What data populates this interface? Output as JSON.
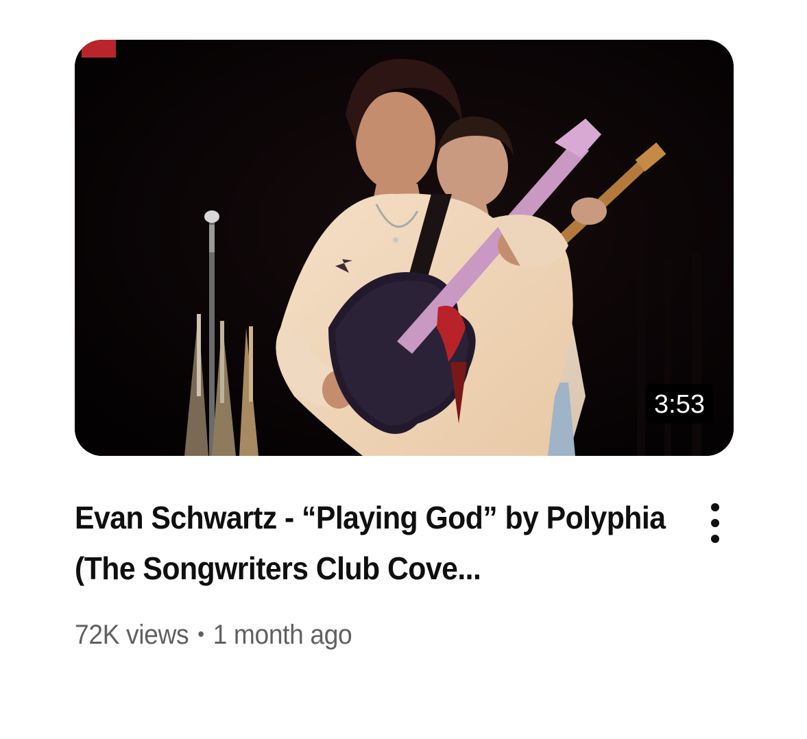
{
  "video": {
    "duration": "3:53",
    "title": "Evan Schwartz - “Playing God” by Polyphia (The Songwriters Club Cove...",
    "views": "72K views",
    "separator": "•",
    "age": "1 month ago"
  },
  "icons": {
    "menu": "more-vert-icon"
  },
  "colors": {
    "title": "#0f0f0f",
    "subtext": "#606060",
    "duration_bg": "#000000",
    "duration_text": "#ffffff"
  }
}
